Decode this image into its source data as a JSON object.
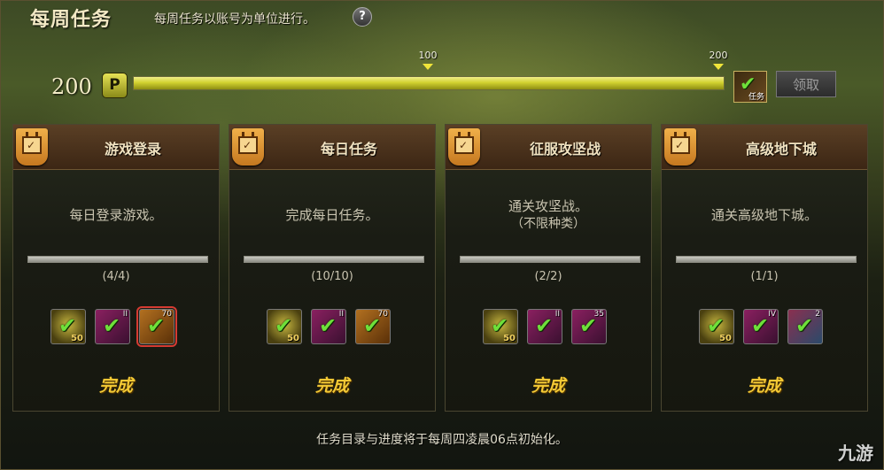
{
  "header": {
    "title": "每周任务",
    "subtitle": "每周任务以账号为单位进行。",
    "help_icon": "question-icon"
  },
  "progress": {
    "score": "200",
    "points_badge": "P",
    "fill_fraction": 1.0,
    "markers": [
      {
        "label": "100",
        "fraction": 0.5
      },
      {
        "label": "200",
        "fraction": 1.0
      }
    ],
    "reward_label": "任务",
    "claim_label": "领取"
  },
  "cards": [
    {
      "name": "游戏登录",
      "desc": [
        "每日登录游戏。"
      ],
      "count": "(4/4)",
      "fill_fraction": 1.0,
      "status": "完成",
      "items": [
        {
          "style": "yellow",
          "qty": "50",
          "lvl": ""
        },
        {
          "style": "pink",
          "qty": "",
          "lvl": "II"
        },
        {
          "style": "brown",
          "qty": "",
          "lvl": "70",
          "selected": true
        }
      ]
    },
    {
      "name": "每日任务",
      "desc": [
        "完成每日任务。"
      ],
      "count": "(10/10)",
      "fill_fraction": 1.0,
      "status": "完成",
      "items": [
        {
          "style": "yellow",
          "qty": "50",
          "lvl": ""
        },
        {
          "style": "pink",
          "qty": "",
          "lvl": "II"
        },
        {
          "style": "brown",
          "qty": "",
          "lvl": "70"
        }
      ]
    },
    {
      "name": "征服攻坚战",
      "desc": [
        "通关攻坚战。",
        "（不限种类）"
      ],
      "count": "(2/2)",
      "fill_fraction": 1.0,
      "status": "完成",
      "items": [
        {
          "style": "yellow",
          "qty": "50",
          "lvl": ""
        },
        {
          "style": "pink",
          "qty": "",
          "lvl": "II"
        },
        {
          "style": "pink",
          "qty": "",
          "lvl": "35"
        }
      ]
    },
    {
      "name": "高级地下城",
      "desc": [
        "通关高级地下城。"
      ],
      "count": "(1/1)",
      "fill_fraction": 1.0,
      "status": "完成",
      "items": [
        {
          "style": "yellow",
          "qty": "50",
          "lvl": ""
        },
        {
          "style": "pink",
          "qty": "",
          "lvl": "IV"
        },
        {
          "style": "map",
          "qty": "",
          "lvl": "2"
        }
      ]
    }
  ],
  "footer": "任务目录与进度将于每周四凌晨06点初始化。",
  "watermark": "九游",
  "colors": {
    "accent": "#f3c935",
    "bar": "#d2d230",
    "check": "#6ee03a",
    "selected_outline": "#d53b32"
  }
}
